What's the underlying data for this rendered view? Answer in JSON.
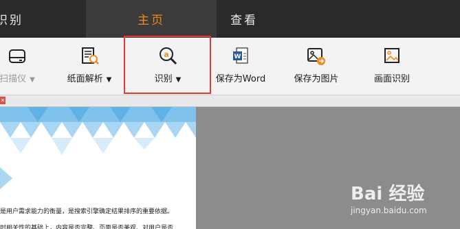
{
  "tabs": {
    "partial_label": "识别",
    "home_label": "主页",
    "view_label": "查看"
  },
  "toolbar": {
    "scanner_label": "扫描仪",
    "paper_parse_label": "纸面解析",
    "recognize_label": "识别",
    "save_word_label": "保存为Word",
    "save_image_label": "保存为图片",
    "screen_recognize_label": "画面识别",
    "caret": "▼"
  },
  "document": {
    "line1": "是用户需求能力的衡量，是搜索引擎确定结果排序的重要依据。",
    "line2": "时相关性的基础上，内容是否完整、页面是否美观、对用户是否"
  },
  "watermark": {
    "logo": "Bai 经验",
    "url": "jingyan.baidu.com"
  },
  "colors": {
    "accent": "#f08a1c",
    "highlight": "#e53935",
    "tabbar": "#2a2a2a",
    "ribbon": "#f3f3f3"
  }
}
